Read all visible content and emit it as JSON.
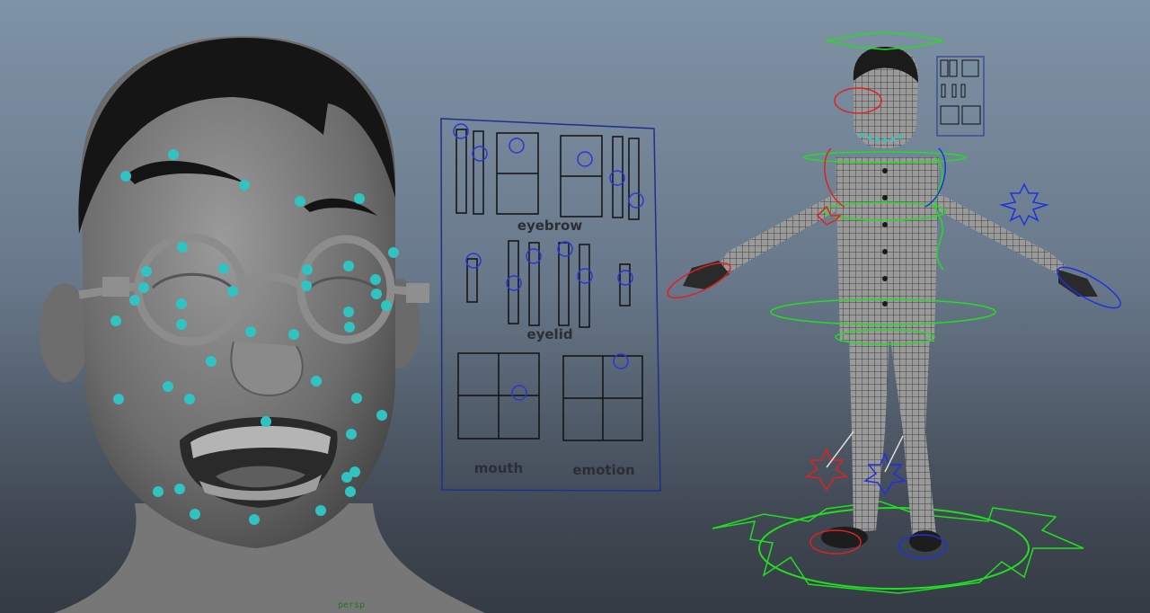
{
  "viewport": {
    "camera": "persp"
  },
  "face_panel": {
    "sections": [
      {
        "label": "eyebrow"
      },
      {
        "label": "eyelid"
      },
      {
        "label": "mouth"
      },
      {
        "label": "emotion"
      }
    ]
  },
  "colors": {
    "background_top": "#7f93a6",
    "background_bottom": "#353b44",
    "joint_markers": "#31c2c2",
    "control_green": "#22dd22",
    "control_red": "#e02020",
    "control_blue": "#2030e0",
    "panel_outline": "#1f2f8f"
  }
}
